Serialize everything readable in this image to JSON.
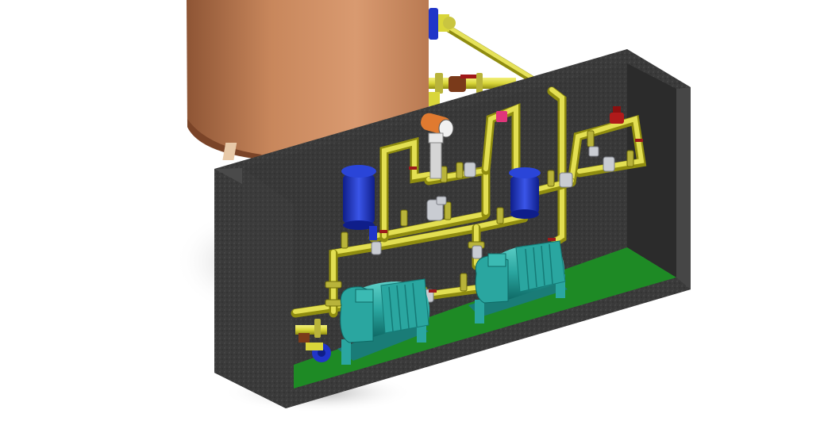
{
  "scene": {
    "background": "#ffffff",
    "colors": {
      "tank": "#c8875c",
      "tank_dark": "#8e5535",
      "tank_light": "#e0a77f",
      "pit_concrete": "#3a3a3a",
      "pit_concrete_dark": "#2a2a2a",
      "pit_rim": "#4a4a4a",
      "floor": "#1e8a25",
      "pipe": "#d9d63a",
      "pipe_dark": "#8f8c10",
      "flange": "#b8b33a",
      "fitting_gray": "#c9ccd2",
      "filter_blue": "#2035c8",
      "pump_body": "#2aa6a0",
      "pump_dark": "#157a76",
      "motor": "#27a8a4",
      "accent_red": "#b01a1a",
      "accent_magenta": "#e0367a",
      "heater_orange": "#e07a30"
    },
    "components": {
      "tank": "storage-tank",
      "pit": "concrete-pit",
      "pumps": [
        "pump-motor-left",
        "pump-motor-right"
      ],
      "filters": [
        "filter-vessel-left",
        "filter-vessel-right"
      ],
      "heater": "electric-heater",
      "valves": [
        "ball-valve-top",
        "relief-valve-right",
        "inlet-valve-bottom"
      ]
    }
  }
}
